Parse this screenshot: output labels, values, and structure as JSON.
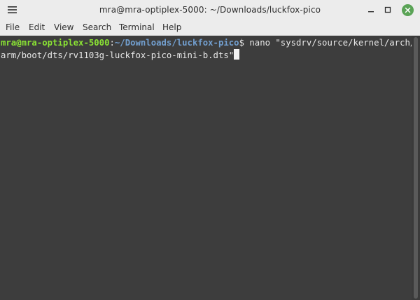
{
  "window": {
    "title": "mra@mra-optiplex-5000: ~/Downloads/luckfox-pico",
    "buttons": {
      "menu_icon": "hamburger-icon",
      "minimize_icon": "minimize-icon",
      "maximize_icon": "maximize-icon",
      "close_icon": "close-icon"
    },
    "close_color": "#5aa356"
  },
  "menubar": {
    "items": [
      "File",
      "Edit",
      "View",
      "Search",
      "Terminal",
      "Help"
    ]
  },
  "terminal": {
    "prompt_user": "mra@mra-optiplex-5000",
    "prompt_sep": ":",
    "prompt_path": "~/Downloads/luckfox-pico",
    "prompt_symbol": "$",
    "command_line1": " nano \"sysdrv/source/kernel/arch/",
    "command_line2": "arm/boot/dts/rv1103g-luckfox-pico-mini-b.dts\"",
    "colors": {
      "background": "#3d3d3d",
      "user": "#8ae234",
      "path": "#729fcf",
      "text": "#e8e8e8"
    }
  }
}
